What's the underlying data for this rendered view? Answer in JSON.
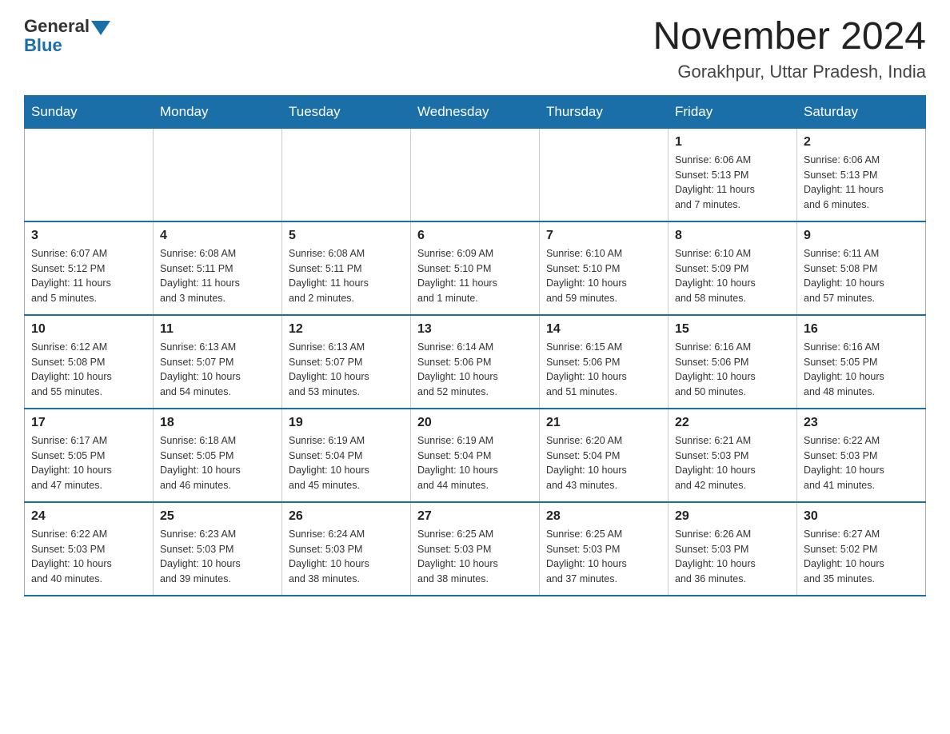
{
  "header": {
    "logo": {
      "general": "General",
      "blue": "Blue"
    },
    "title": "November 2024",
    "location": "Gorakhpur, Uttar Pradesh, India"
  },
  "weekdays": [
    "Sunday",
    "Monday",
    "Tuesday",
    "Wednesday",
    "Thursday",
    "Friday",
    "Saturday"
  ],
  "weeks": [
    [
      {
        "day": "",
        "info": ""
      },
      {
        "day": "",
        "info": ""
      },
      {
        "day": "",
        "info": ""
      },
      {
        "day": "",
        "info": ""
      },
      {
        "day": "",
        "info": ""
      },
      {
        "day": "1",
        "info": "Sunrise: 6:06 AM\nSunset: 5:13 PM\nDaylight: 11 hours\nand 7 minutes."
      },
      {
        "day": "2",
        "info": "Sunrise: 6:06 AM\nSunset: 5:13 PM\nDaylight: 11 hours\nand 6 minutes."
      }
    ],
    [
      {
        "day": "3",
        "info": "Sunrise: 6:07 AM\nSunset: 5:12 PM\nDaylight: 11 hours\nand 5 minutes."
      },
      {
        "day": "4",
        "info": "Sunrise: 6:08 AM\nSunset: 5:11 PM\nDaylight: 11 hours\nand 3 minutes."
      },
      {
        "day": "5",
        "info": "Sunrise: 6:08 AM\nSunset: 5:11 PM\nDaylight: 11 hours\nand 2 minutes."
      },
      {
        "day": "6",
        "info": "Sunrise: 6:09 AM\nSunset: 5:10 PM\nDaylight: 11 hours\nand 1 minute."
      },
      {
        "day": "7",
        "info": "Sunrise: 6:10 AM\nSunset: 5:10 PM\nDaylight: 10 hours\nand 59 minutes."
      },
      {
        "day": "8",
        "info": "Sunrise: 6:10 AM\nSunset: 5:09 PM\nDaylight: 10 hours\nand 58 minutes."
      },
      {
        "day": "9",
        "info": "Sunrise: 6:11 AM\nSunset: 5:08 PM\nDaylight: 10 hours\nand 57 minutes."
      }
    ],
    [
      {
        "day": "10",
        "info": "Sunrise: 6:12 AM\nSunset: 5:08 PM\nDaylight: 10 hours\nand 55 minutes."
      },
      {
        "day": "11",
        "info": "Sunrise: 6:13 AM\nSunset: 5:07 PM\nDaylight: 10 hours\nand 54 minutes."
      },
      {
        "day": "12",
        "info": "Sunrise: 6:13 AM\nSunset: 5:07 PM\nDaylight: 10 hours\nand 53 minutes."
      },
      {
        "day": "13",
        "info": "Sunrise: 6:14 AM\nSunset: 5:06 PM\nDaylight: 10 hours\nand 52 minutes."
      },
      {
        "day": "14",
        "info": "Sunrise: 6:15 AM\nSunset: 5:06 PM\nDaylight: 10 hours\nand 51 minutes."
      },
      {
        "day": "15",
        "info": "Sunrise: 6:16 AM\nSunset: 5:06 PM\nDaylight: 10 hours\nand 50 minutes."
      },
      {
        "day": "16",
        "info": "Sunrise: 6:16 AM\nSunset: 5:05 PM\nDaylight: 10 hours\nand 48 minutes."
      }
    ],
    [
      {
        "day": "17",
        "info": "Sunrise: 6:17 AM\nSunset: 5:05 PM\nDaylight: 10 hours\nand 47 minutes."
      },
      {
        "day": "18",
        "info": "Sunrise: 6:18 AM\nSunset: 5:05 PM\nDaylight: 10 hours\nand 46 minutes."
      },
      {
        "day": "19",
        "info": "Sunrise: 6:19 AM\nSunset: 5:04 PM\nDaylight: 10 hours\nand 45 minutes."
      },
      {
        "day": "20",
        "info": "Sunrise: 6:19 AM\nSunset: 5:04 PM\nDaylight: 10 hours\nand 44 minutes."
      },
      {
        "day": "21",
        "info": "Sunrise: 6:20 AM\nSunset: 5:04 PM\nDaylight: 10 hours\nand 43 minutes."
      },
      {
        "day": "22",
        "info": "Sunrise: 6:21 AM\nSunset: 5:03 PM\nDaylight: 10 hours\nand 42 minutes."
      },
      {
        "day": "23",
        "info": "Sunrise: 6:22 AM\nSunset: 5:03 PM\nDaylight: 10 hours\nand 41 minutes."
      }
    ],
    [
      {
        "day": "24",
        "info": "Sunrise: 6:22 AM\nSunset: 5:03 PM\nDaylight: 10 hours\nand 40 minutes."
      },
      {
        "day": "25",
        "info": "Sunrise: 6:23 AM\nSunset: 5:03 PM\nDaylight: 10 hours\nand 39 minutes."
      },
      {
        "day": "26",
        "info": "Sunrise: 6:24 AM\nSunset: 5:03 PM\nDaylight: 10 hours\nand 38 minutes."
      },
      {
        "day": "27",
        "info": "Sunrise: 6:25 AM\nSunset: 5:03 PM\nDaylight: 10 hours\nand 38 minutes."
      },
      {
        "day": "28",
        "info": "Sunrise: 6:25 AM\nSunset: 5:03 PM\nDaylight: 10 hours\nand 37 minutes."
      },
      {
        "day": "29",
        "info": "Sunrise: 6:26 AM\nSunset: 5:03 PM\nDaylight: 10 hours\nand 36 minutes."
      },
      {
        "day": "30",
        "info": "Sunrise: 6:27 AM\nSunset: 5:02 PM\nDaylight: 10 hours\nand 35 minutes."
      }
    ]
  ]
}
